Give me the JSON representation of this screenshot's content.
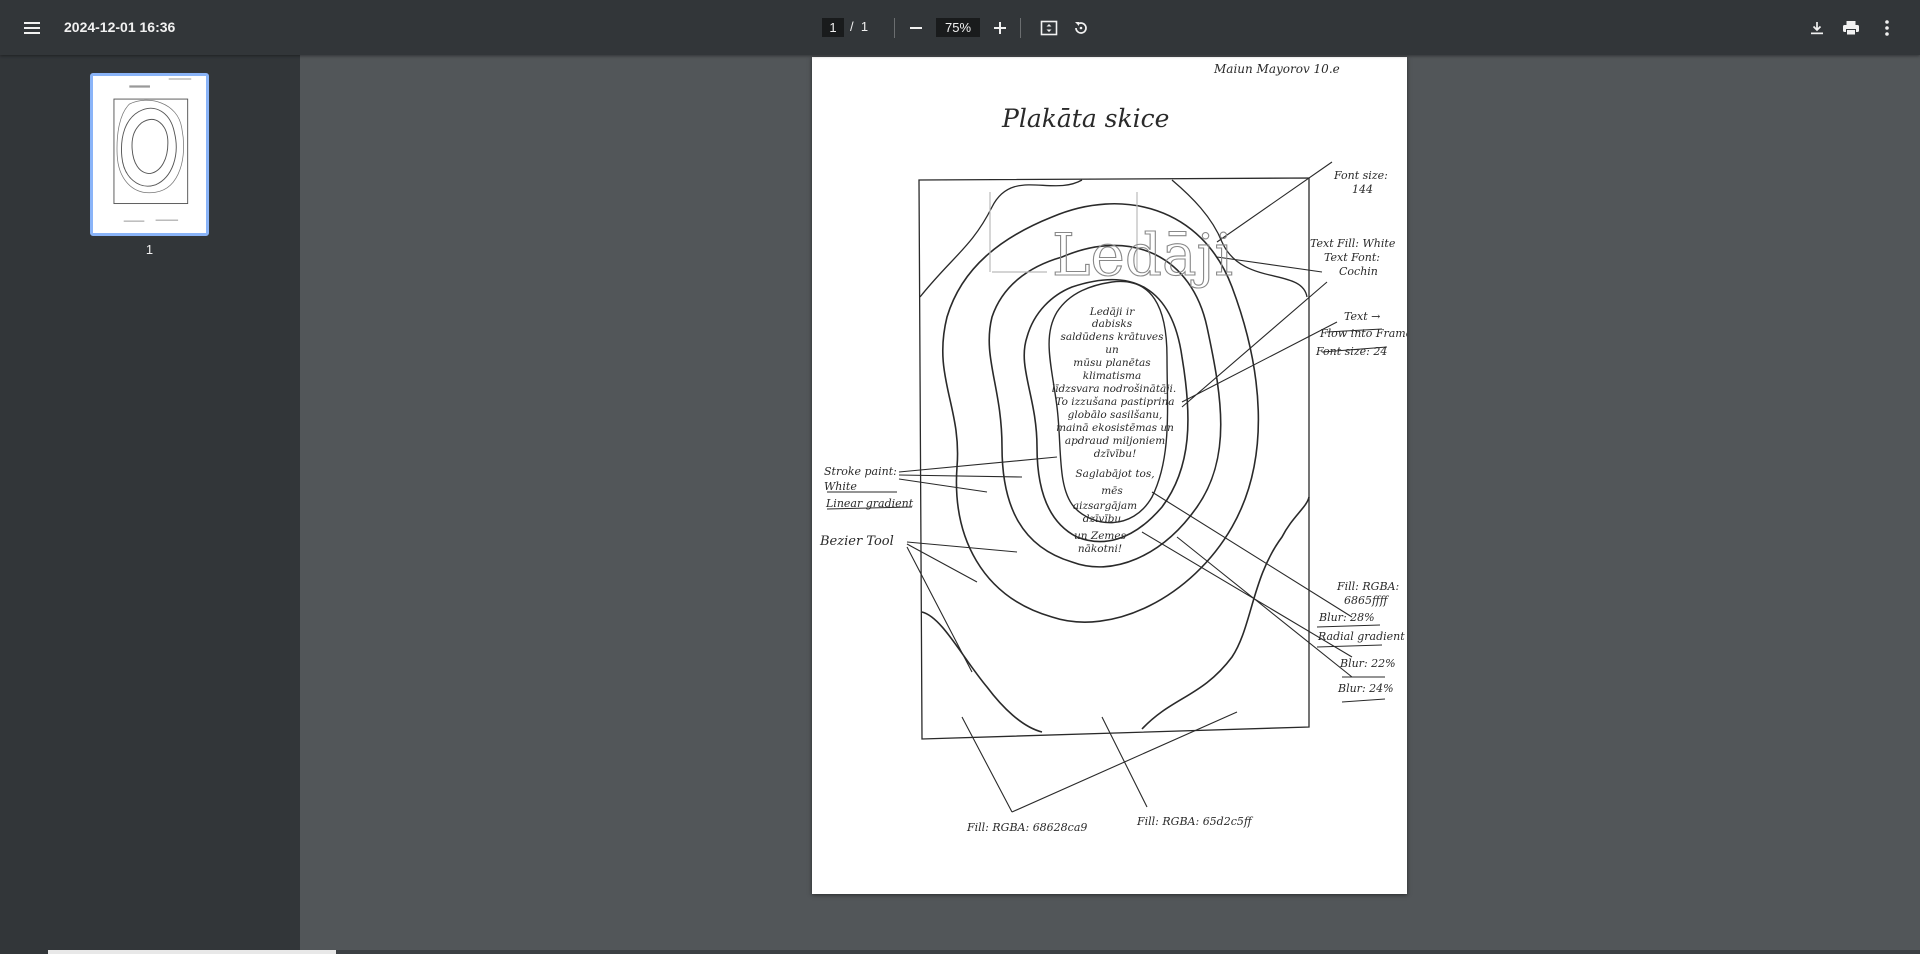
{
  "toolbar": {
    "title": "2024-12-01 16:36",
    "current_page": "1",
    "page_separator": "/",
    "total_pages": "1",
    "zoom": "75%"
  },
  "sidebar": {
    "thumbnail_label": "1"
  },
  "document": {
    "author": "Maiun Mayorov 10.e",
    "title": "Plakāta skice",
    "headline": "Ledāji",
    "annotations": {
      "font_size": [
        "Font size:",
        "144"
      ],
      "text_fill": [
        "Text Fill: White",
        "Text Font:",
        "Cochin"
      ],
      "text_frame": [
        "Text →",
        "Flow into Frame",
        "Font size: 24"
      ],
      "stroke": [
        "Stroke paint:",
        "White",
        "Linear gradient"
      ],
      "bezier": "Bezier Tool",
      "fill_blue": [
        "Fill: RGBA:",
        "6865ffff",
        "Blur: 28%",
        "Radial gradient"
      ],
      "blur22": "Blur: 22%",
      "blur24": "Blur: 24%",
      "fill_bottom_left": "Fill: RGBA: 68628ca9",
      "fill_bottom_right": "Fill: RGBA: 65d2c5ff"
    },
    "body_text": [
      "Ledāji ir",
      "dabisks",
      "saldūdens krātuves",
      "un",
      "mūsu planētas",
      "klimatisma",
      "līdzsvara nodrošinātāji.",
      "To izzušana pastiprina",
      "globālo sasilšanu,",
      "mainā ekosistēmas un",
      "apdraud miljoniem",
      "dzīvību!",
      "Saglabājot tos,",
      "mēs",
      "aizsargājam",
      "dzīvību",
      "un Zemes",
      "nākotni!"
    ]
  },
  "icons": {
    "menu": "menu-icon",
    "zoom_out": "minus-icon",
    "zoom_in": "plus-icon",
    "fit": "fit-page-icon",
    "rotate": "rotate-icon",
    "download": "download-icon",
    "print": "print-icon",
    "more": "more-vert-icon"
  }
}
